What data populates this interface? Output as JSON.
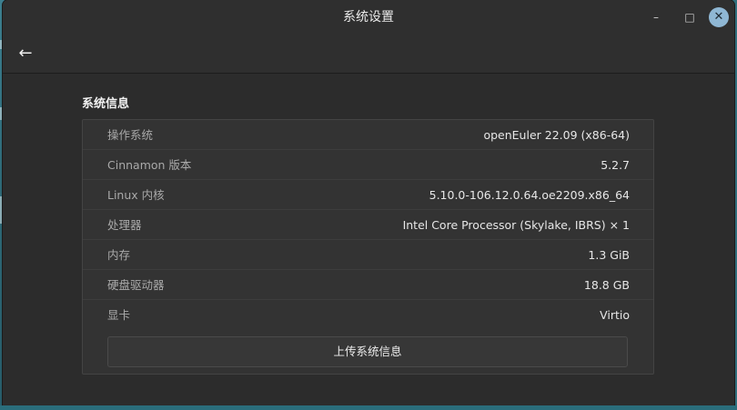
{
  "window": {
    "title": "系统设置",
    "minimize_glyph": "–",
    "maximize_glyph": "□",
    "close_glyph": "✕"
  },
  "header": {
    "back_glyph": "←"
  },
  "section": {
    "title": "系统信息"
  },
  "info_rows": [
    {
      "label": "操作系统",
      "value": "openEuler 22.09 (x86-64)"
    },
    {
      "label": "Cinnamon 版本",
      "value": "5.2.7"
    },
    {
      "label": "Linux 内核",
      "value": "5.10.0-106.12.0.64.oe2209.x86_64"
    },
    {
      "label": "处理器",
      "value": "Intel Core Processor (Skylake, IBRS) × 1"
    },
    {
      "label": "内存",
      "value": "1.3 GiB"
    },
    {
      "label": "硬盘驱动器",
      "value": "18.8 GB"
    },
    {
      "label": "显卡",
      "value": "Virtio"
    }
  ],
  "actions": {
    "upload_label": "上传系统信息"
  },
  "colors": {
    "accent_close": "#8fb7d4",
    "window_bg": "#2c2c2c",
    "desktop": "#2f6f7d"
  }
}
